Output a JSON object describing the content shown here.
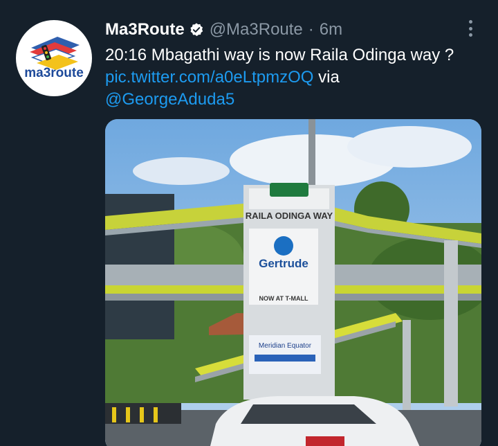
{
  "tweet": {
    "author_name": "Ma3Route",
    "handle": "@Ma3Route",
    "separator": "·",
    "time": "6m",
    "verified_icon": "verified-badge-icon",
    "more_icon": "more-vertical-icon",
    "text": "20:16 Mbagathi way is now Raila Odinga way ?",
    "link": "pic.twitter.com/a0eLtpmzOQ",
    "via": "via",
    "mention": "@GeorgeAduda5"
  },
  "avatar": {
    "logo_text": "ma3route"
  },
  "photo": {
    "road_sign": "RAILA ODINGA WAY",
    "sign_brand_1": "Gertrude",
    "sign_line_1": "NOW AT T-MALL",
    "sign_brand_2": "Meridian Equator"
  },
  "colors": {
    "background": "#15202b",
    "text": "#ffffff",
    "muted": "#8b98a5",
    "link": "#1d9bf0"
  }
}
